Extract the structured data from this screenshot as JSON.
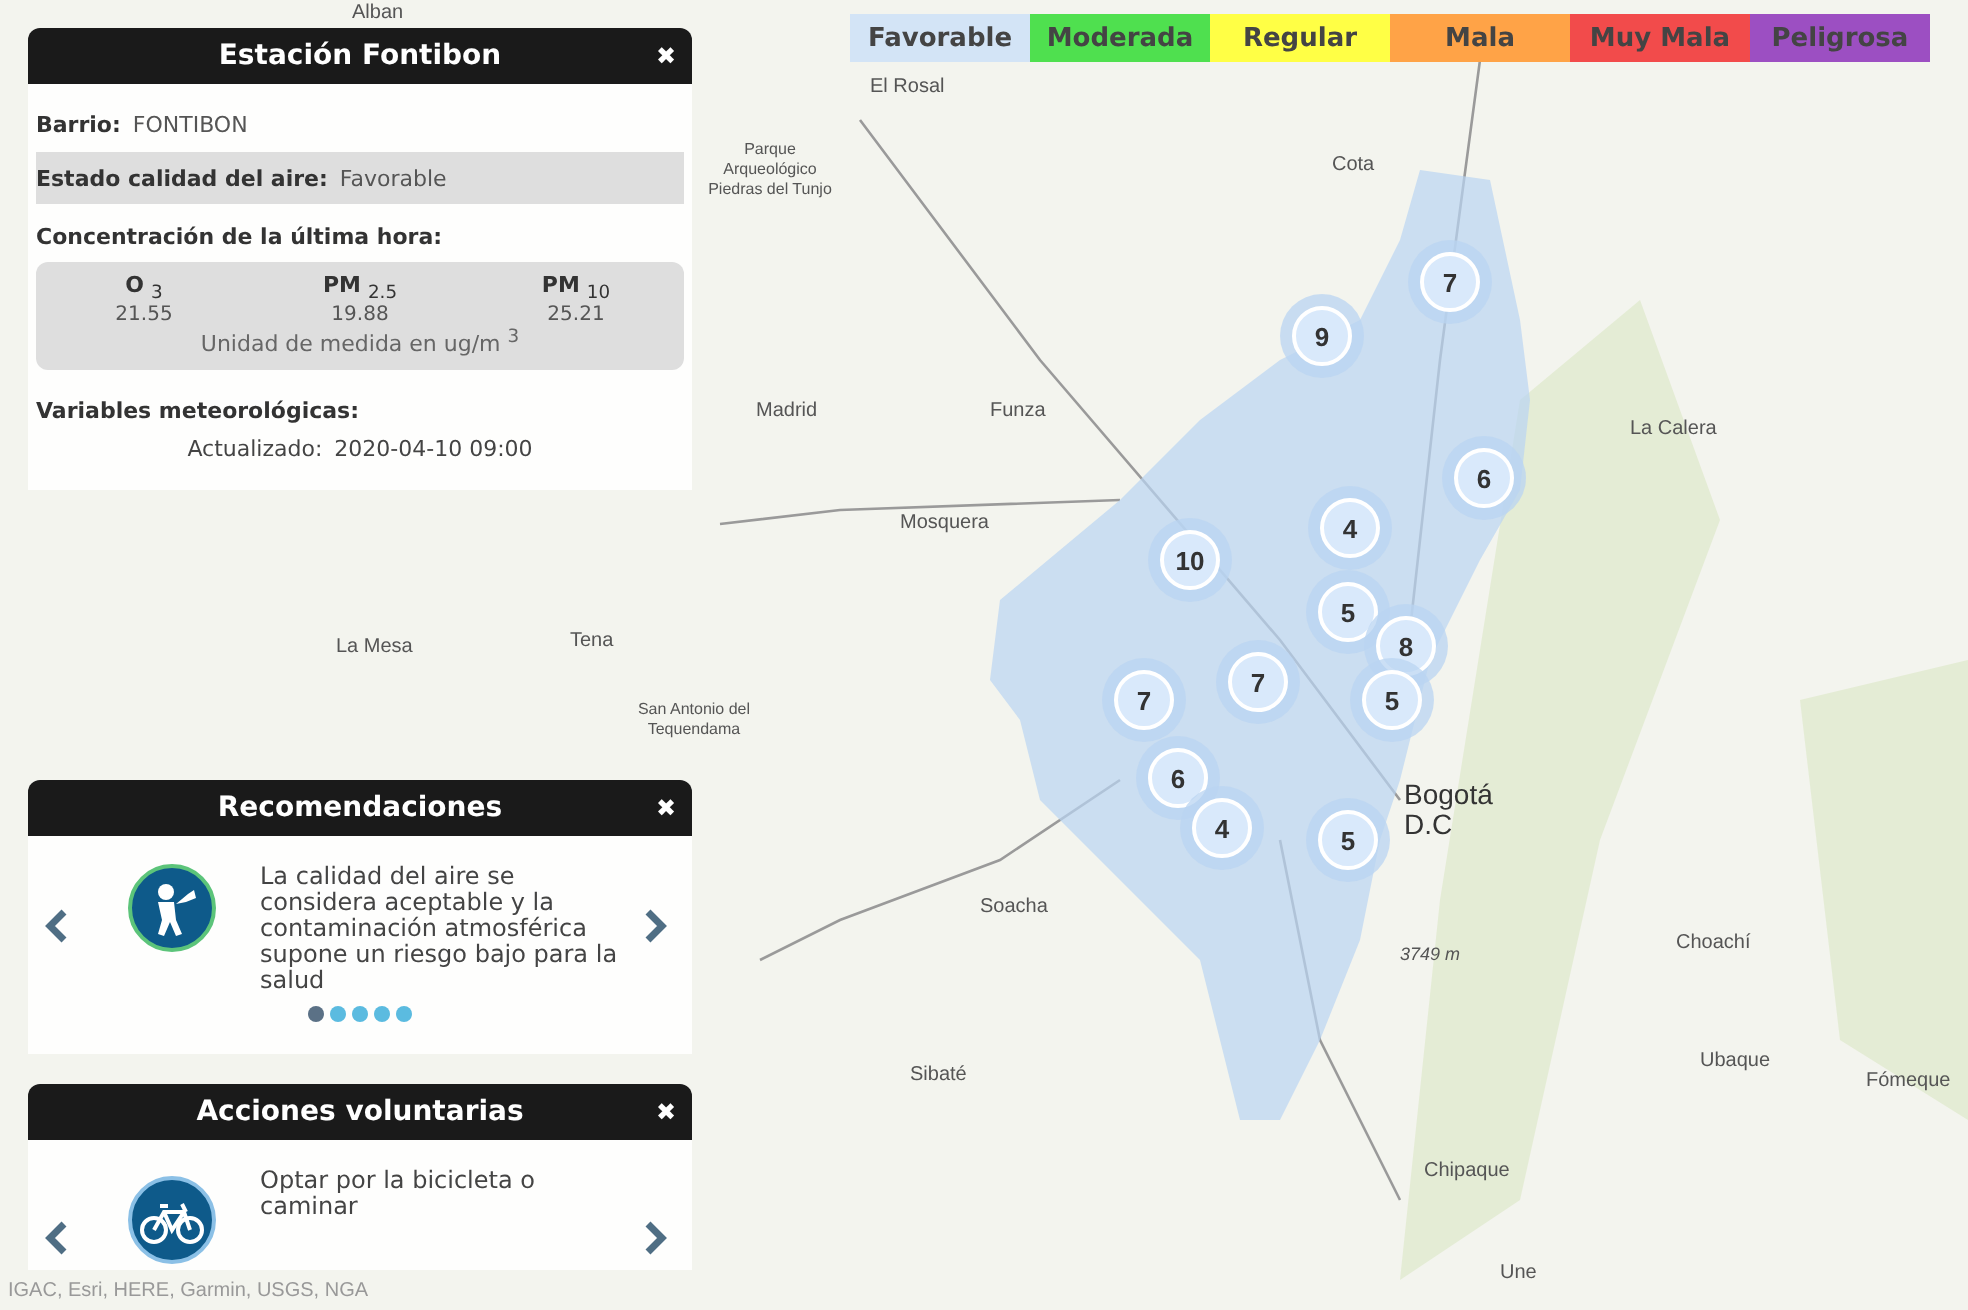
{
  "legend": [
    {
      "label": "Favorable",
      "color": "#d3e4f6"
    },
    {
      "label": "Moderada",
      "color": "#4fe04f"
    },
    {
      "label": "Regular",
      "color": "#ffff45"
    },
    {
      "label": "Mala",
      "color": "#ffa347"
    },
    {
      "label": "Muy Mala",
      "color": "#f24b4b"
    },
    {
      "label": "Peligrosa",
      "color": "#9c4fc2"
    }
  ],
  "station": {
    "title": "Estación Fontibon",
    "close": "✖",
    "barrio": {
      "label": "Barrio:",
      "value": "FONTIBON"
    },
    "estado": {
      "label": "Estado calidad del aire:",
      "value": "Favorable"
    },
    "concentration_title": "Concentración de la última hora:",
    "pollutants": [
      {
        "name": "**O** $_{3}$",
        "value": "21.55"
      },
      {
        "name": "**PM** $_{2.5}$",
        "value": "19.88"
      },
      {
        "name": "**PM** $_{10}$",
        "value": "25.21"
      }
    ],
    "unit": "Unidad de medida en ug/m $^{3}$",
    "meteo_title": "Variables meteorológicas:",
    "updated": {
      "label": "Actualizado:",
      "value": "2020-04-10 09:00"
    }
  },
  "recommendations": {
    "title": "Recomendaciones",
    "close": "✖",
    "text": "La calidad del aire se considera aceptable y la contaminación atmosférica supone un riesgo bajo para la salud",
    "dots": [
      {
        "selected": true
      },
      {
        "selected": false
      },
      {
        "selected": false
      },
      {
        "selected": false
      },
      {
        "selected": false
      }
    ]
  },
  "actions": {
    "title": "Acciones voluntarias",
    "close": "✖",
    "text": "Optar por la bicicleta o caminar"
  },
  "map": {
    "places": [
      {
        "label": "Alban"
      },
      {
        "label": "El Rosal"
      },
      {
        "label": "Parque Arqueológico Piedras del Tunjo"
      },
      {
        "label": "Madrid"
      },
      {
        "label": "Funza"
      },
      {
        "label": "Mosquera"
      },
      {
        "label": "Cota"
      },
      {
        "label": "La Calera"
      },
      {
        "label": "Bogotá D.C"
      },
      {
        "label": "Soacha"
      },
      {
        "label": "Sibaté"
      },
      {
        "label": "Choachí"
      },
      {
        "label": "Ubaque"
      },
      {
        "label": "Fómeque"
      },
      {
        "label": "Chipaque"
      },
      {
        "label": "Une"
      },
      {
        "label": "La Mesa"
      },
      {
        "label": "Tena"
      },
      {
        "label": "San Antonio del Tequendama"
      },
      {
        "label": "3749 m"
      }
    ],
    "markers": [
      {
        "label": "7"
      },
      {
        "label": "9"
      },
      {
        "label": "6"
      },
      {
        "label": "4"
      },
      {
        "label": "10"
      },
      {
        "label": "5"
      },
      {
        "label": "8"
      },
      {
        "label": "7"
      },
      {
        "label": "7"
      },
      {
        "label": "5"
      },
      {
        "label": "6"
      },
      {
        "label": "4"
      },
      {
        "label": "5"
      }
    ],
    "attribution": "IGAC, Esri, HERE, Garmin, USGS, NGA"
  }
}
